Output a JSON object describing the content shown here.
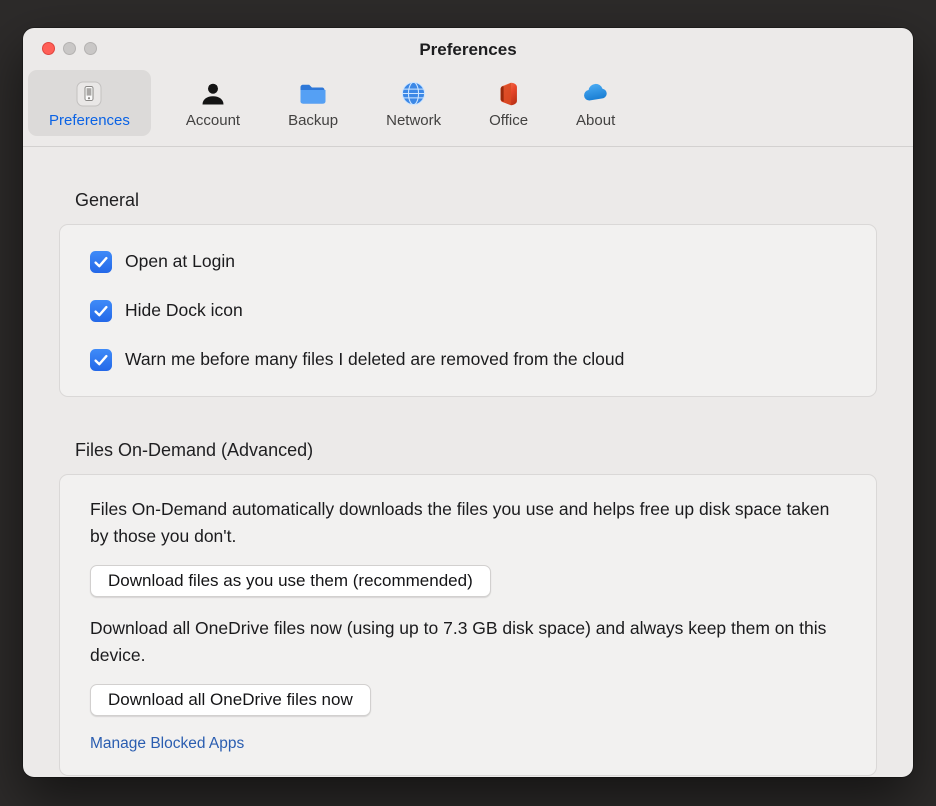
{
  "window": {
    "title": "Preferences"
  },
  "toolbar": {
    "tabs": [
      {
        "label": "Preferences",
        "icon": "device-icon",
        "selected": true
      },
      {
        "label": "Account",
        "icon": "person-icon",
        "selected": false
      },
      {
        "label": "Backup",
        "icon": "folder-icon",
        "selected": false
      },
      {
        "label": "Network",
        "icon": "globe-icon",
        "selected": false
      },
      {
        "label": "Office",
        "icon": "office-icon",
        "selected": false
      },
      {
        "label": "About",
        "icon": "cloud-icon",
        "selected": false
      }
    ]
  },
  "general": {
    "heading": "General",
    "checkboxes": [
      {
        "label": "Open at Login",
        "checked": true
      },
      {
        "label": "Hide Dock icon",
        "checked": true
      },
      {
        "label": "Warn me before many files I deleted are removed from the cloud",
        "checked": true
      }
    ]
  },
  "files_on_demand": {
    "heading": "Files On-Demand (Advanced)",
    "description": "Files On-Demand automatically downloads the files you use and helps free up disk space taken by those you don't.",
    "download_as_used_button": "Download files as you use them (recommended)",
    "download_all_text": "Download all OneDrive files now (using up to 7.3 GB disk space) and always keep them on this device.",
    "download_all_button": "Download all OneDrive files now",
    "manage_blocked_apps_link": "Manage Blocked Apps"
  },
  "colors": {
    "accent_blue": "#2f7cf6",
    "selected_tab_label": "#0b63e5",
    "link_blue": "#2a5db0",
    "close_button_red": "#ff5f57"
  }
}
